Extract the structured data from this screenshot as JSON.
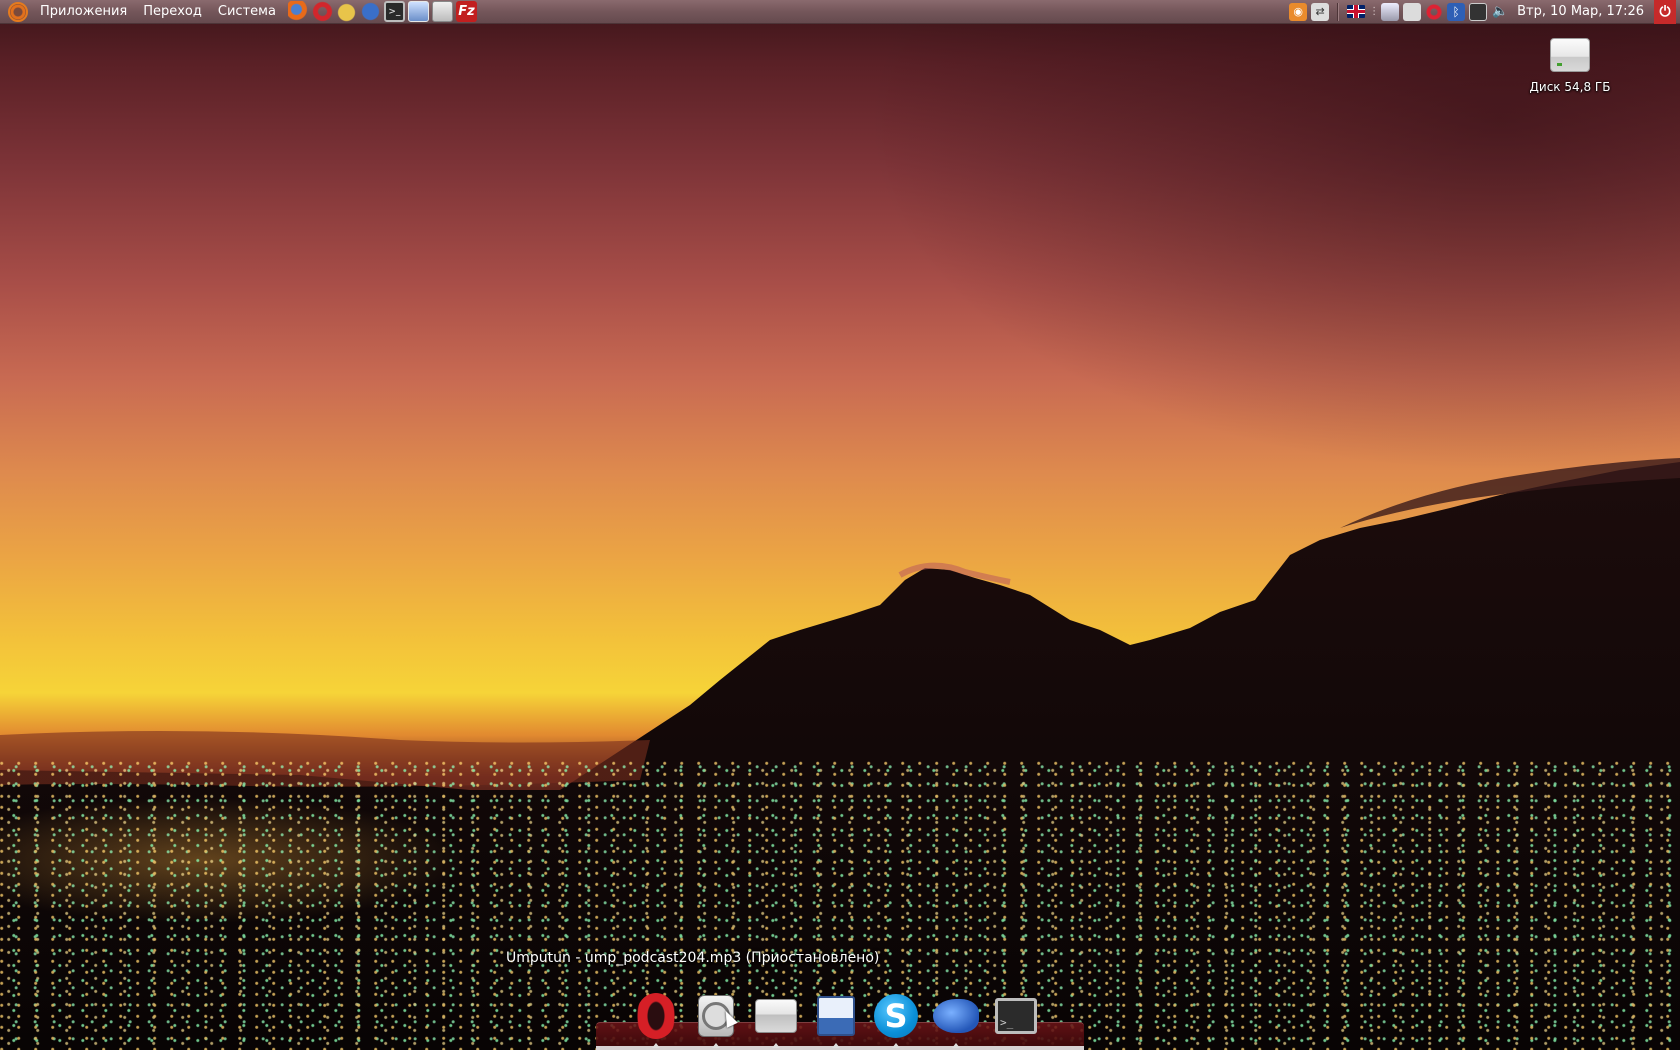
{
  "top_panel": {
    "menus": [
      "Приложения",
      "Переход",
      "Система"
    ],
    "launchers": [
      {
        "name": "firefox-icon",
        "glyph": ""
      },
      {
        "name": "opera-icon",
        "glyph": ""
      },
      {
        "name": "pidgin-icon",
        "glyph": ""
      },
      {
        "name": "bluefish-icon",
        "glyph": ""
      },
      {
        "name": "terminal-icon",
        "glyph": ">_"
      },
      {
        "name": "screenshot-icon",
        "glyph": ""
      },
      {
        "name": "sound-recorder-icon",
        "glyph": ""
      },
      {
        "name": "filezilla-icon",
        "glyph": "Fz"
      }
    ],
    "clock": "Втр, 10 Мар, 17:26"
  },
  "desktop": {
    "icons": [
      {
        "label": "Диск 54,8 ГБ",
        "icon": "drive-icon"
      }
    ]
  },
  "dock": {
    "tooltip": "Umputun - ump_podcast204.mp3 (Приостановлено)",
    "items": [
      {
        "name": "opera",
        "icon": "opera-icon",
        "running": true
      },
      {
        "name": "sound-player",
        "icon": "sound-player-icon",
        "running": true
      },
      {
        "name": "drive",
        "icon": "drive-icon",
        "running": true
      },
      {
        "name": "screenshot",
        "icon": "screenshot-icon",
        "running": true
      },
      {
        "name": "skype",
        "icon": "skype-icon",
        "running": true,
        "glyph": "S"
      },
      {
        "name": "bluefish",
        "icon": "bluefish-icon",
        "running": true
      },
      {
        "name": "terminal",
        "icon": "terminal-icon",
        "running": false,
        "glyph": ">_"
      }
    ]
  },
  "colors": {
    "panel": "#74565a",
    "accent_orange": "#e2701c",
    "power_red": "#c62a2a"
  }
}
